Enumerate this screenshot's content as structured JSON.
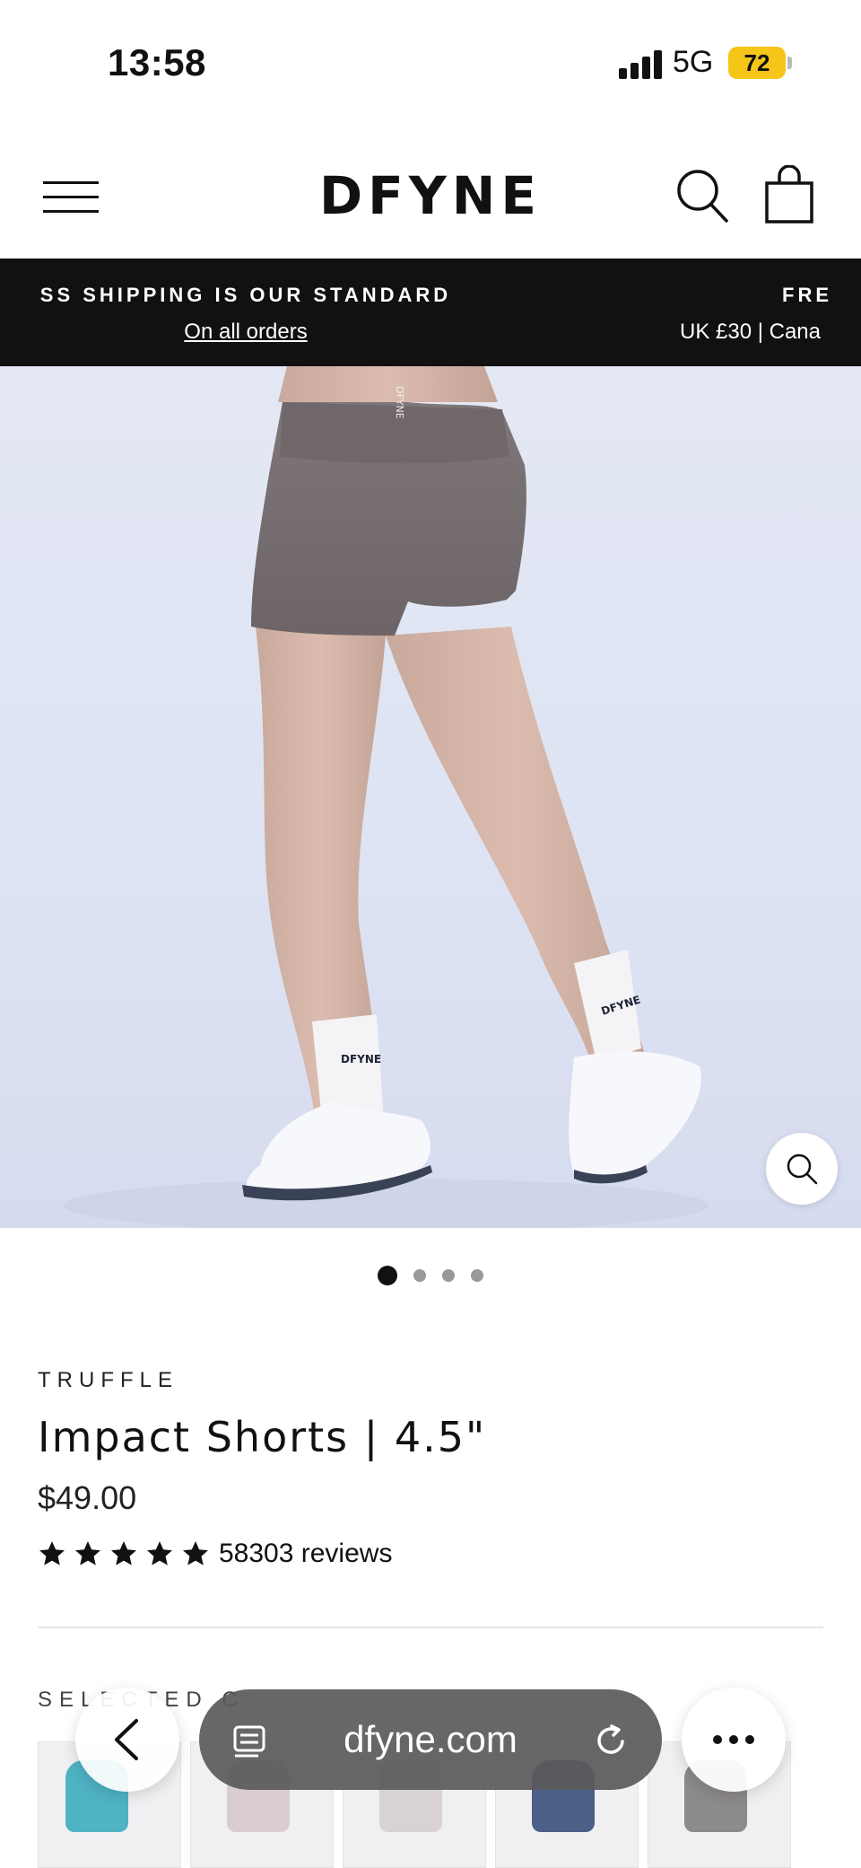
{
  "status_bar": {
    "time": "13:58",
    "network": "5G",
    "battery": "72"
  },
  "header": {
    "logo": "DFYNE",
    "icons": [
      "menu-icon",
      "search-icon",
      "cart-icon"
    ]
  },
  "announcement": {
    "items": [
      {
        "title": "SS SHIPPING IS OUR STANDARD",
        "subtitle": "On all orders"
      },
      {
        "title": "FRE",
        "subtitle": "UK £30 | Cana"
      }
    ]
  },
  "gallery": {
    "slide_count": 4,
    "active_slide": 1,
    "sock_text": "DFYNE",
    "waistband_text": "DFYNE"
  },
  "product": {
    "color": "TRUFFLE",
    "title": "Impact Shorts | 4.5\"",
    "price": "$49.00",
    "rating": 5,
    "reviews": "58303 reviews"
  },
  "colors_section": {
    "label": "SELECTED C"
  },
  "browser": {
    "url": "dfyne.com"
  },
  "colors": {
    "shorts": "#7a7274",
    "background": "#e2e7f4",
    "announcement_bg": "#111111"
  }
}
